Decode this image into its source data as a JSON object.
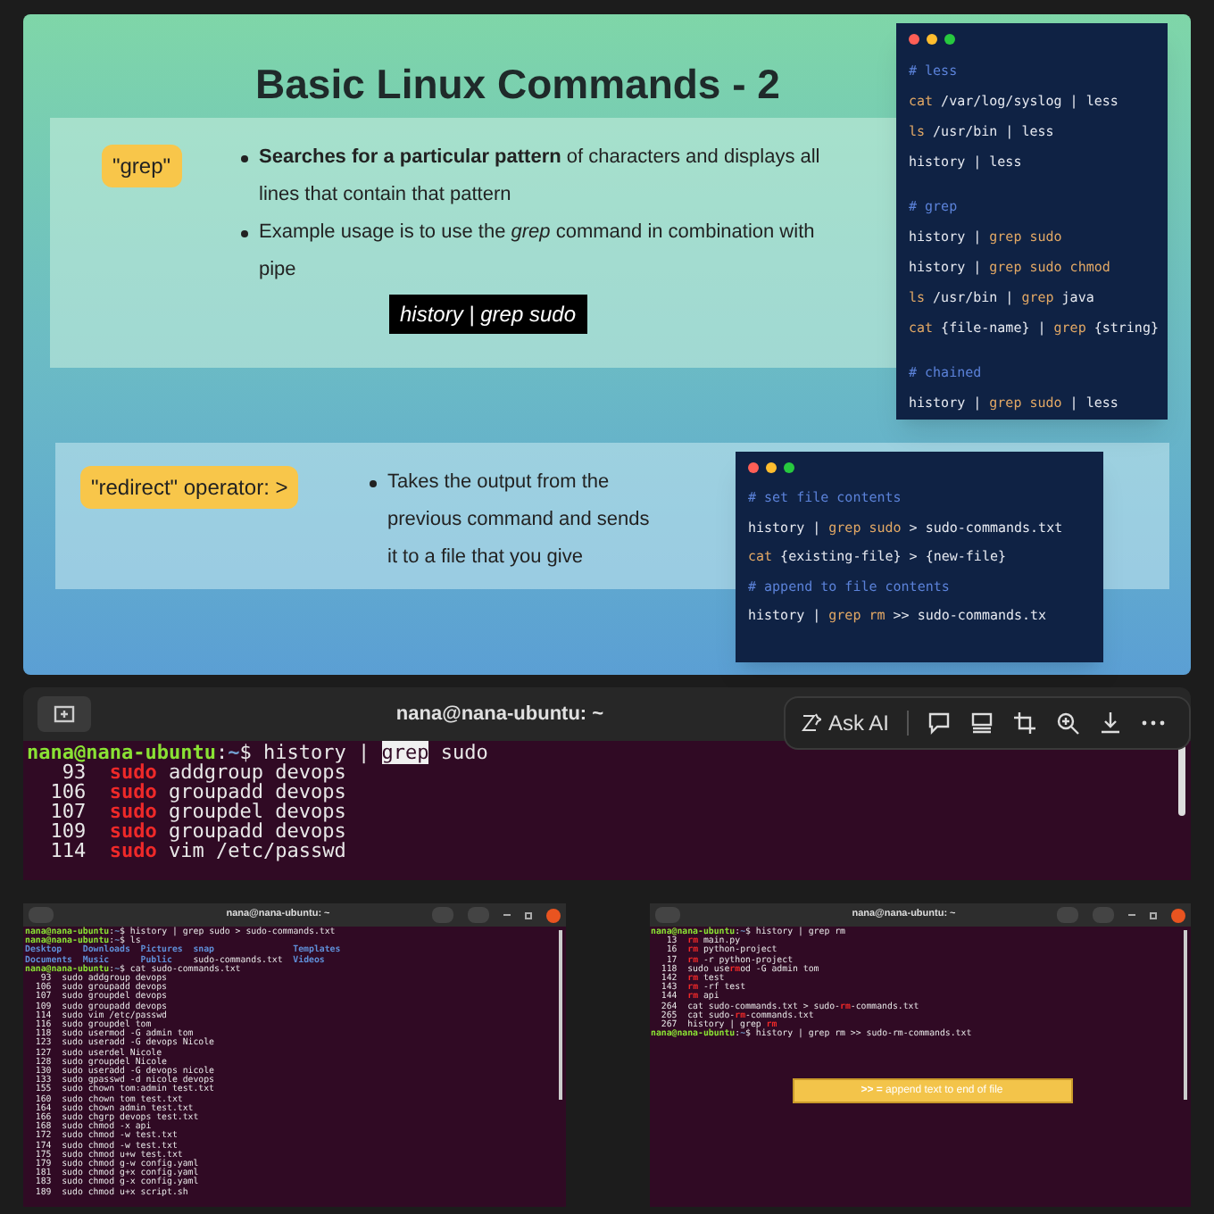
{
  "slide": {
    "title": "Basic Linux Commands - 2",
    "sections": [
      {
        "tag": "\"grep\"",
        "bullets": [
          "**Searches for a particular pattern** of characters and displays all lines that contain that pattern",
          "Example usage is to use the *grep* command in combination with pipe"
        ],
        "example": "history | grep sudo"
      },
      {
        "tag": "\"redirect\" operator: >",
        "bullets": [
          "Takes the output from the previous command and sends it to a file that you give"
        ]
      }
    ],
    "code_panels": [
      {
        "blocks": [
          [
            [
              {
                "text": "# less",
                "kind": "comment"
              }
            ],
            [
              {
                "text": "cat",
                "kind": "keyword"
              },
              {
                "text": " /var/log/syslog | less",
                "kind": "text"
              }
            ],
            [
              {
                "text": "ls",
                "kind": "keyword"
              },
              {
                "text": " /usr/bin | less",
                "kind": "text"
              }
            ],
            [
              {
                "text": "history | less",
                "kind": "text"
              }
            ]
          ],
          [
            [
              {
                "text": "# grep",
                "kind": "comment"
              }
            ],
            [
              {
                "text": "history | ",
                "kind": "text"
              },
              {
                "text": "grep sudo",
                "kind": "keyword"
              }
            ],
            [
              {
                "text": "history | ",
                "kind": "text"
              },
              {
                "text": "grep sudo chmod",
                "kind": "keyword"
              }
            ],
            [
              {
                "text": "ls",
                "kind": "keyword"
              },
              {
                "text": " /usr/bin | ",
                "kind": "text"
              },
              {
                "text": "grep",
                "kind": "keyword"
              },
              {
                "text": " java",
                "kind": "text"
              }
            ],
            [
              {
                "text": "cat",
                "kind": "keyword"
              },
              {
                "text": " {file-name} | ",
                "kind": "text"
              },
              {
                "text": "grep",
                "kind": "keyword"
              },
              {
                "text": " {string}",
                "kind": "text"
              }
            ]
          ],
          [
            [
              {
                "text": "# chained",
                "kind": "comment"
              }
            ],
            [
              {
                "text": "history | ",
                "kind": "text"
              },
              {
                "text": "grep sudo",
                "kind": "keyword"
              },
              {
                "text": " | less",
                "kind": "text"
              }
            ]
          ]
        ]
      },
      {
        "blocks": [
          [
            [
              {
                "text": "# set file contents",
                "kind": "comment"
              }
            ],
            [
              {
                "text": "history | ",
                "kind": "text"
              },
              {
                "text": "grep sudo",
                "kind": "keyword"
              },
              {
                "text": " > sudo-commands.txt",
                "kind": "text"
              }
            ],
            [
              {
                "text": "cat",
                "kind": "keyword"
              },
              {
                "text": " {existing-file} > {new-file}",
                "kind": "text"
              }
            ],
            [
              {
                "text": "# append to file contents",
                "kind": "comment"
              }
            ],
            [
              {
                "text": "history | ",
                "kind": "text"
              },
              {
                "text": "grep rm",
                "kind": "keyword"
              },
              {
                "text": " >> sudo-commands.tx",
                "kind": "text"
              }
            ]
          ]
        ]
      }
    ]
  },
  "main_terminal": {
    "title": "nana@nana-ubuntu: ~",
    "toolbar": {
      "ask_ai": "Ask AI"
    },
    "lines": [
      [
        {
          "text": "nana@nana-ubuntu",
          "kind": "user"
        },
        {
          "text": ":",
          "kind": "text"
        },
        {
          "text": "~",
          "kind": "path"
        },
        {
          "text": "$ history | ",
          "kind": "text"
        },
        {
          "text": "grep",
          "kind": "highlight"
        },
        {
          "text": " sudo",
          "kind": "text"
        }
      ],
      [
        {
          "text": "   93  ",
          "kind": "text"
        },
        {
          "text": "sudo",
          "kind": "match"
        },
        {
          "text": " addgroup devops",
          "kind": "text"
        }
      ],
      [
        {
          "text": "  106  ",
          "kind": "text"
        },
        {
          "text": "sudo",
          "kind": "match"
        },
        {
          "text": " groupadd devops",
          "kind": "text"
        }
      ],
      [
        {
          "text": "  107  ",
          "kind": "text"
        },
        {
          "text": "sudo",
          "kind": "match"
        },
        {
          "text": " groupdel devops",
          "kind": "text"
        }
      ],
      [
        {
          "text": "  109  ",
          "kind": "text"
        },
        {
          "text": "sudo",
          "kind": "match"
        },
        {
          "text": " groupadd devops",
          "kind": "text"
        }
      ],
      [
        {
          "text": "  114  ",
          "kind": "text"
        },
        {
          "text": "sudo",
          "kind": "match"
        },
        {
          "text": " vim /etc/passwd",
          "kind": "text"
        }
      ]
    ]
  },
  "small_terminals": [
    {
      "title": "nana@nana-ubuntu: ~",
      "lines": [
        [
          {
            "text": "nana@nana-ubuntu",
            "kind": "user"
          },
          {
            "text": ":",
            "kind": "text"
          },
          {
            "text": "~",
            "kind": "path"
          },
          {
            "text": "$ history | grep sudo > sudo-commands.txt",
            "kind": "text"
          }
        ],
        [
          {
            "text": "nana@nana-ubuntu",
            "kind": "user"
          },
          {
            "text": ":",
            "kind": "text"
          },
          {
            "text": "~",
            "kind": "path"
          },
          {
            "text": "$ ls",
            "kind": "text"
          }
        ],
        [
          {
            "text": "Desktop    Downloads  Pictures  snap               Templates",
            "kind": "dir"
          }
        ],
        [
          {
            "text": "Documents  Music      Public    ",
            "kind": "dir"
          },
          {
            "text": "sudo-commands.txt",
            "kind": "text"
          },
          {
            "text": "  Videos",
            "kind": "dir"
          }
        ],
        [
          {
            "text": "nana@nana-ubuntu",
            "kind": "user"
          },
          {
            "text": ":",
            "kind": "text"
          },
          {
            "text": "~",
            "kind": "path"
          },
          {
            "text": "$ cat sudo-commands.txt",
            "kind": "text"
          }
        ],
        [
          {
            "text": "   93  sudo addgroup devops",
            "kind": "text"
          }
        ],
        [
          {
            "text": "  106  sudo groupadd devops",
            "kind": "text"
          }
        ],
        [
          {
            "text": "  107  sudo groupdel devops",
            "kind": "text"
          }
        ],
        [
          {
            "text": "  109  sudo groupadd devops",
            "kind": "text"
          }
        ],
        [
          {
            "text": "  114  sudo vim /etc/passwd",
            "kind": "text"
          }
        ],
        [
          {
            "text": "  116  sudo groupdel tom",
            "kind": "text"
          }
        ],
        [
          {
            "text": "  118  sudo usermod -G admin tom",
            "kind": "text"
          }
        ],
        [
          {
            "text": "  123  sudo useradd -G devops Nicole",
            "kind": "text"
          }
        ],
        [
          {
            "text": "  127  sudo userdel Nicole",
            "kind": "text"
          }
        ],
        [
          {
            "text": "  128  sudo groupdel Nicole",
            "kind": "text"
          }
        ],
        [
          {
            "text": "  130  sudo useradd -G devops nicole",
            "kind": "text"
          }
        ],
        [
          {
            "text": "  133  sudo gpasswd -d nicole devops",
            "kind": "text"
          }
        ],
        [
          {
            "text": "  155  sudo chown tom:admin test.txt",
            "kind": "text"
          }
        ],
        [
          {
            "text": "  160  sudo chown tom test.txt",
            "kind": "text"
          }
        ],
        [
          {
            "text": "  164  sudo chown admin test.txt",
            "kind": "text"
          }
        ],
        [
          {
            "text": "  166  sudo chgrp devops test.txt",
            "kind": "text"
          }
        ],
        [
          {
            "text": "  168  sudo chmod -x api",
            "kind": "text"
          }
        ],
        [
          {
            "text": "  172  sudo chmod -w test.txt",
            "kind": "text"
          }
        ],
        [
          {
            "text": "  174  sudo chmod -w test.txt",
            "kind": "text"
          }
        ],
        [
          {
            "text": "  175  sudo chmod u+w test.txt",
            "kind": "text"
          }
        ],
        [
          {
            "text": "  179  sudo chmod g-w config.yaml",
            "kind": "text"
          }
        ],
        [
          {
            "text": "  181  sudo chmod g+x config.yaml",
            "kind": "text"
          }
        ],
        [
          {
            "text": "  183  sudo chmod g-x config.yaml",
            "kind": "text"
          }
        ],
        [
          {
            "text": "  189  sudo chmod u+x script.sh",
            "kind": "text"
          }
        ]
      ]
    },
    {
      "title": "nana@nana-ubuntu: ~",
      "lines": [
        [
          {
            "text": "nana@nana-ubuntu",
            "kind": "user"
          },
          {
            "text": ":",
            "kind": "text"
          },
          {
            "text": "~",
            "kind": "path"
          },
          {
            "text": "$ history | grep rm",
            "kind": "text"
          }
        ],
        [
          {
            "text": "   13  ",
            "kind": "text"
          },
          {
            "text": "rm",
            "kind": "match"
          },
          {
            "text": " main.py",
            "kind": "text"
          }
        ],
        [
          {
            "text": "   16  ",
            "kind": "text"
          },
          {
            "text": "rm",
            "kind": "match"
          },
          {
            "text": " python-project",
            "kind": "text"
          }
        ],
        [
          {
            "text": "   17  ",
            "kind": "text"
          },
          {
            "text": "rm",
            "kind": "match"
          },
          {
            "text": " -r python-project",
            "kind": "text"
          }
        ],
        [
          {
            "text": "  118  sudo use",
            "kind": "text"
          },
          {
            "text": "rm",
            "kind": "match"
          },
          {
            "text": "od -G admin tom",
            "kind": "text"
          }
        ],
        [
          {
            "text": "  142  ",
            "kind": "text"
          },
          {
            "text": "rm",
            "kind": "match"
          },
          {
            "text": " test",
            "kind": "text"
          }
        ],
        [
          {
            "text": "  143  ",
            "kind": "text"
          },
          {
            "text": "rm",
            "kind": "match"
          },
          {
            "text": " -rf test",
            "kind": "text"
          }
        ],
        [
          {
            "text": "  144  ",
            "kind": "text"
          },
          {
            "text": "rm",
            "kind": "match"
          },
          {
            "text": " api",
            "kind": "text"
          }
        ],
        [
          {
            "text": "  264  cat sudo-commands.txt > sudo-",
            "kind": "text"
          },
          {
            "text": "rm",
            "kind": "match"
          },
          {
            "text": "-commands.txt",
            "kind": "text"
          }
        ],
        [
          {
            "text": "  265  cat sudo-",
            "kind": "text"
          },
          {
            "text": "rm",
            "kind": "match"
          },
          {
            "text": "-commands.txt",
            "kind": "text"
          }
        ],
        [
          {
            "text": "  267  history | grep ",
            "kind": "text"
          },
          {
            "text": "rm",
            "kind": "match"
          }
        ],
        [
          {
            "text": "nana@nana-ubuntu",
            "kind": "user"
          },
          {
            "text": ":",
            "kind": "text"
          },
          {
            "text": "~",
            "kind": "path"
          },
          {
            "text": "$ history | grep rm >> sudo-rm-commands.txt",
            "kind": "text"
          }
        ]
      ],
      "banner": "**>> =** append text to end of file"
    }
  ]
}
